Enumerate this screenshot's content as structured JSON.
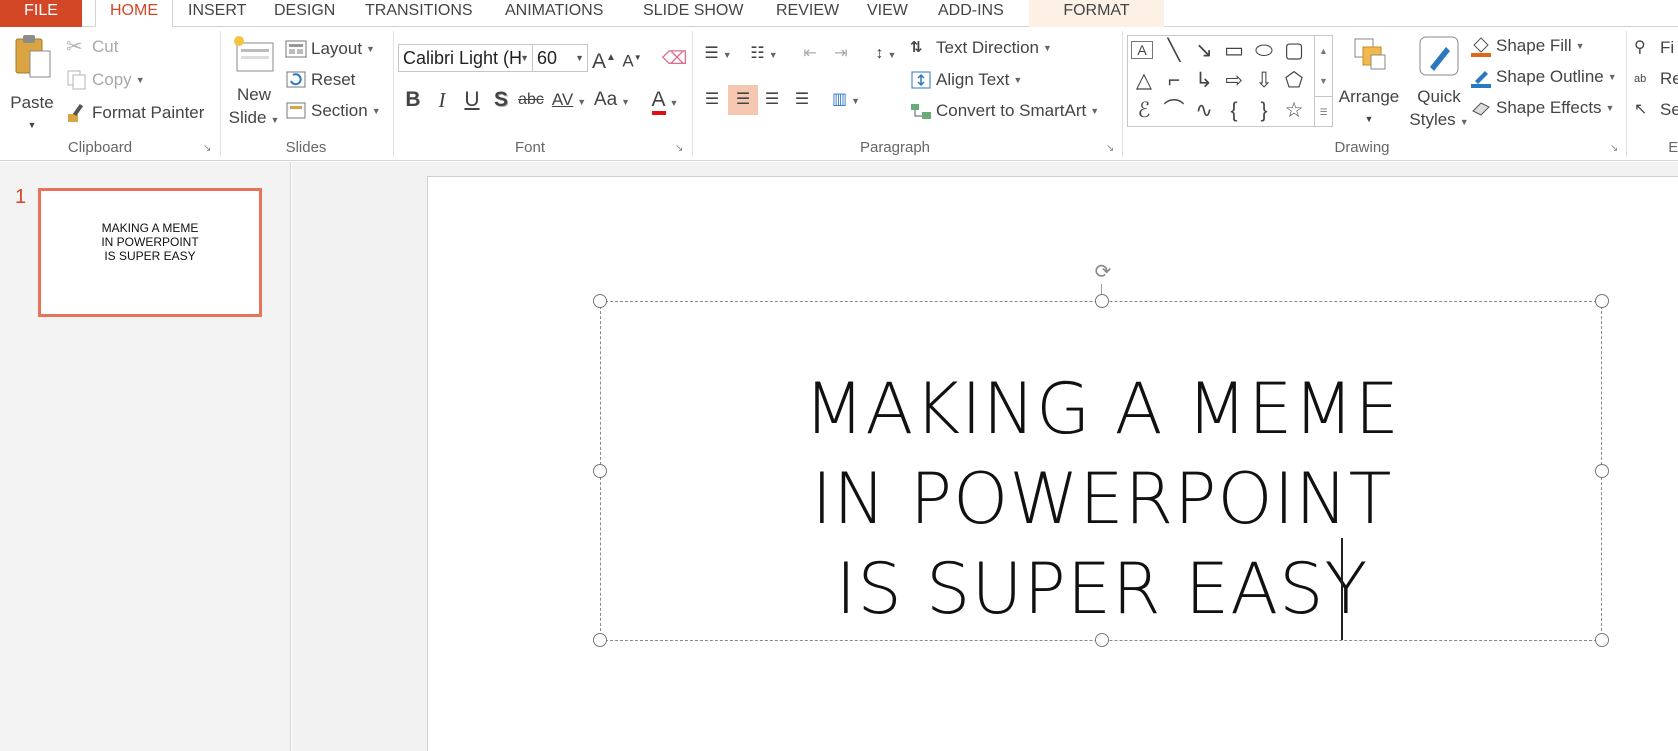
{
  "tabs": {
    "file": "FILE",
    "home": "HOME",
    "insert": "INSERT",
    "design": "DESIGN",
    "transitions": "TRANSITIONS",
    "animations": "ANIMATIONS",
    "slide_show": "SLIDE SHOW",
    "review": "REVIEW",
    "view": "VIEW",
    "add_ins": "ADD-INS",
    "format": "FORMAT"
  },
  "clipboard": {
    "paste": "Paste",
    "cut": "Cut",
    "copy": "Copy",
    "format_painter": "Format Painter",
    "label": "Clipboard"
  },
  "slides_group": {
    "new_slide_line1": "New",
    "new_slide_line2": "Slide",
    "layout": "Layout",
    "reset": "Reset",
    "section": "Section",
    "label": "Slides"
  },
  "font": {
    "font_name": "Calibri Light (H",
    "font_size": "60",
    "bold": "B",
    "italic": "I",
    "underline": "U",
    "shadow": "S",
    "strikethrough": "abc",
    "char_spacing": "AV",
    "change_case": "Aa",
    "font_color": "A",
    "grow": "A",
    "shrink": "A",
    "label": "Font",
    "font_color_value": "#e01010"
  },
  "paragraph": {
    "text_direction": "Text Direction",
    "align_text": "Align Text",
    "convert_smartart": "Convert to SmartArt",
    "label": "Paragraph",
    "active_alignment": "center"
  },
  "drawing": {
    "arrange": "Arrange",
    "quick_styles_line1": "Quick",
    "quick_styles_line2": "Styles",
    "shape_fill": "Shape Fill",
    "shape_outline": "Shape Outline",
    "shape_effects": "Shape Effects",
    "label": "Drawing"
  },
  "editing": {
    "find": "Fi",
    "replace": "Re",
    "select": "Se",
    "label": "Ec"
  },
  "thumbnails": {
    "slide_number": "1",
    "lines": [
      "MAKING A MEME",
      "IN POWERPOINT",
      "IS SUPER EASY"
    ]
  },
  "slide": {
    "title_lines": [
      "MAKING A MEME",
      "IN POWERPOINT",
      "IS SUPER EASY"
    ]
  },
  "colors": {
    "accent": "#d24726",
    "thumb_border": "#e8735a",
    "format_tab_bg": "#fdf1e6",
    "align_active_bg": "#f5c6b0"
  }
}
